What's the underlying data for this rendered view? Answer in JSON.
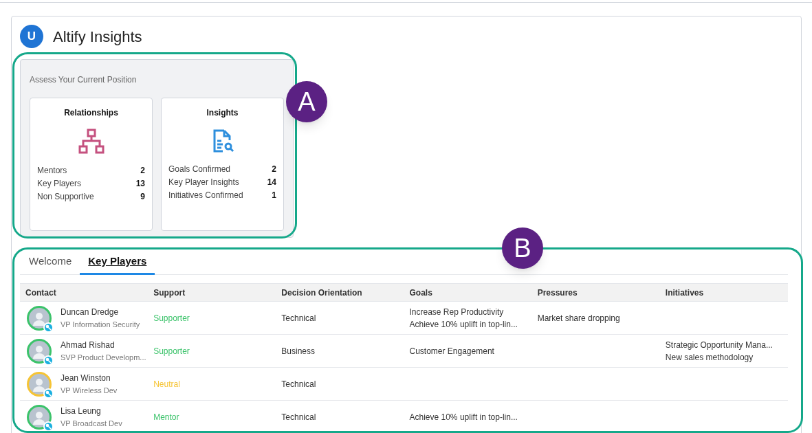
{
  "app": {
    "logo_letter": "U",
    "title": "Altify Insights"
  },
  "position": {
    "title": "Assess Your Current Position",
    "cards": [
      {
        "kind": "relationships",
        "title": "Relationships",
        "stats": [
          {
            "label": "Mentors",
            "value": "2"
          },
          {
            "label": "Key Players",
            "value": "13"
          },
          {
            "label": "Non Supportive",
            "value": "9"
          }
        ]
      },
      {
        "kind": "insights",
        "title": "Insights",
        "stats": [
          {
            "label": "Goals Confirmed",
            "value": "2"
          },
          {
            "label": "Key Player Insights",
            "value": "14"
          },
          {
            "label": "Initiatives Confirmed",
            "value": "1"
          }
        ]
      }
    ]
  },
  "tabs": [
    {
      "label": "Welcome",
      "selected": false
    },
    {
      "label": "Key Players",
      "selected": true
    }
  ],
  "table": {
    "columns": [
      "Contact",
      "Support",
      "Decision Orientation",
      "Goals",
      "Pressures",
      "Initiatives"
    ],
    "rows": [
      {
        "name": "Duncan Dredge",
        "role": "VP Information Security",
        "support": "Supporter",
        "color": "#3cc36b",
        "orientation": "Technical",
        "goals": [
          "Increase Rep Productivity",
          "Achieve 10% uplift in top-lin..."
        ],
        "pressures": [
          "Market share dropping"
        ],
        "initiatives": []
      },
      {
        "name": "Ahmad Rishad",
        "role": "SVP Product Developm...",
        "support": "Supporter",
        "color": "#3cc36b",
        "orientation": "Business",
        "goals": [
          "Customer Engagement"
        ],
        "pressures": [],
        "initiatives": [
          "Strategic Opportunity Mana...",
          "New sales methodology"
        ]
      },
      {
        "name": "Jean Winston",
        "role": "VP Wireless Dev",
        "support": "Neutral",
        "color": "#f6c435",
        "orientation": "Technical",
        "goals": [],
        "pressures": [],
        "initiatives": []
      },
      {
        "name": "Lisa Leung",
        "role": "VP Broadcast Dev",
        "support": "Mentor",
        "color": "#3cc36b",
        "orientation": "Technical",
        "goals": [
          "Achieve 10% uplift in top-lin..."
        ],
        "pressures": [],
        "initiatives": []
      }
    ]
  },
  "callouts": [
    {
      "label": "A"
    },
    {
      "label": "B"
    }
  ]
}
